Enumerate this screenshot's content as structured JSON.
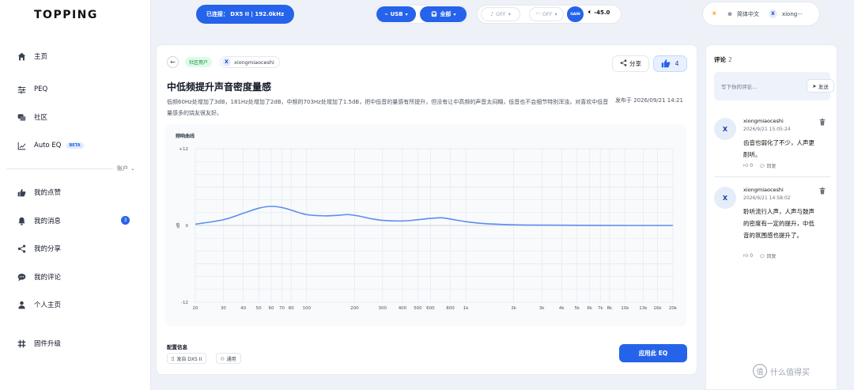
{
  "logo": "TOPPING",
  "sidebar": {
    "items": [
      {
        "label": "主页",
        "icon": "home-icon"
      },
      {
        "label": "PEQ",
        "icon": "sliders-icon"
      },
      {
        "label": "社区",
        "icon": "community-icon"
      },
      {
        "label": "Auto EQ",
        "icon": "chart-line-icon",
        "badge": "BETA"
      }
    ],
    "account_label": "账户",
    "account_items": [
      {
        "label": "我的点赞",
        "icon": "thumbs-up-icon"
      },
      {
        "label": "我的消息",
        "icon": "bell-icon",
        "count": "3"
      },
      {
        "label": "我的分享",
        "icon": "share-icon"
      },
      {
        "label": "我的评论",
        "icon": "comment-icon"
      },
      {
        "label": "个人主页",
        "icon": "user-icon"
      },
      {
        "label": "固件升级",
        "icon": "firmware-icon"
      }
    ]
  },
  "topbar": {
    "connected_label": "已连接： DX5 II  |  192.0kHz",
    "usb_label": "USB",
    "all_label": "全部",
    "off1": "OFF",
    "off2": "OFF",
    "gain_label": "GAIN",
    "volume": "-45.0",
    "language": "简体中文",
    "user_initial": "X",
    "username": "xiong···"
  },
  "post": {
    "tag": "社区用户",
    "author_initial": "X",
    "author": "xiongmiaoceshi",
    "share_label": "分享",
    "likes": "4",
    "title": "中低频提升声音密度量感",
    "description": "低频60Hz处增加了3dB，181Hz处增加了2dB，中频的703Hz处增加了1.5dB，把中低音的量感有所提升，但没有让中高频的声音太闷糊，低音也不会细节特别浑浊，对喜欢中低音量感多的烧友很友好。",
    "published": "发布于 2026/09/21 14:21",
    "chart_title": "频响曲线",
    "config_label": "配置信息",
    "device_chip": "发自 DX5 II",
    "scope_chip": "通用",
    "apply_label": "应用此 EQ"
  },
  "chart_data": {
    "type": "line",
    "title": "频响曲线",
    "ylabel": "dB",
    "xscale": "log",
    "ylim": [
      -12,
      12
    ],
    "xlim": [
      20,
      20000
    ],
    "y_ticks": [
      "+12",
      "0",
      "-12"
    ],
    "x_ticks": [
      20,
      30,
      40,
      50,
      60,
      70,
      80,
      100,
      200,
      300,
      400,
      500,
      600,
      800,
      1000,
      2000,
      3000,
      4000,
      5000,
      6000,
      7000,
      8000,
      10000,
      13000,
      16000,
      20000
    ],
    "x_tick_labels": [
      "20",
      "30",
      "40",
      "50",
      "60",
      "70",
      "80",
      "100",
      "200",
      "300",
      "400",
      "500",
      "600",
      "800",
      "1k",
      "2k",
      "3k",
      "4k",
      "5k",
      "6k",
      "7k",
      "8k",
      "10k",
      "13k",
      "16k",
      "20k"
    ],
    "grid": true,
    "series": [
      {
        "x": [
          20,
          30,
          40,
          50,
          60,
          70,
          80,
          100,
          130,
          160,
          181,
          210,
          250,
          300,
          400,
          500,
          600,
          703,
          800,
          1000,
          1300,
          2000,
          3000,
          5000,
          10000,
          20000
        ],
        "y": [
          0.2,
          0.9,
          1.9,
          2.7,
          3.0,
          2.8,
          2.4,
          1.7,
          1.5,
          1.6,
          1.7,
          1.5,
          1.1,
          0.8,
          0.7,
          0.9,
          1.1,
          1.2,
          1.0,
          0.6,
          0.3,
          0.1,
          0.05,
          0.02,
          0.0,
          0.0
        ]
      }
    ]
  },
  "comments": {
    "header": "评论",
    "count": "2",
    "placeholder": "写下你的评论...",
    "send_label": "发送",
    "items": [
      {
        "initial": "X",
        "user": "xiongmiaoceshi",
        "time": "2026/9/21 15:05:24",
        "text": "齿音也弱化了不少，人声更耐听。",
        "likes": "0",
        "reply": "回复"
      },
      {
        "initial": "X",
        "user": "xiongmiaoceshi",
        "time": "2026/9/21 14:58:02",
        "text": "聆听流行人声，人声与鼓声的密度有一定的提升，中低音的氛围感也提升了。",
        "likes": "0",
        "reply": "回复"
      }
    ]
  },
  "watermark": "什么值得买"
}
